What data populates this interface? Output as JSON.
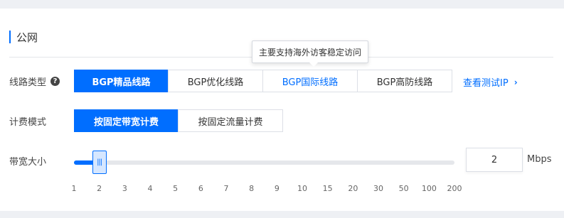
{
  "section": {
    "title": "公网"
  },
  "line_type": {
    "label": "线路类型",
    "help_icon": "question-circle-icon",
    "options": [
      "BGP精品线路",
      "BGP优化线路",
      "BGP国际线路",
      "BGP高防线路"
    ],
    "selected": "BGP精品线路",
    "hovered": "BGP国际线路",
    "tooltip": "主要支持海外访客稳定访问",
    "link": "查看测试IP",
    "link_icon": "chevron-right-icon"
  },
  "billing": {
    "label": "计费模式",
    "options": [
      "按固定带宽计费",
      "按固定流量计费"
    ],
    "selected": "按固定带宽计费"
  },
  "bandwidth": {
    "label": "带宽大小",
    "value": "2",
    "unit": "Mbps",
    "ticks": [
      "1",
      "2",
      "3",
      "4",
      "5",
      "6",
      "7",
      "8",
      "9",
      "10",
      "15",
      "20",
      "30",
      "50",
      "100",
      "200"
    ],
    "handle_icon": "slider-grip-icon"
  },
  "colors": {
    "accent": "#006eff",
    "track": "#e5e7eb",
    "border": "#dcdfe6"
  }
}
